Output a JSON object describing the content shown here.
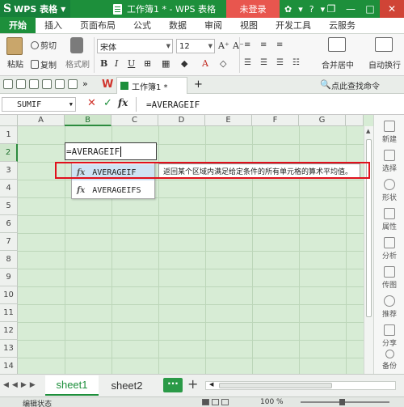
{
  "app": {
    "logo_text": "WPS 表格",
    "doc_title": "工作簿1 * - WPS 表格",
    "login_button": "未登录"
  },
  "menu_tabs": [
    "开始",
    "插入",
    "页面布局",
    "公式",
    "数据",
    "审阅",
    "视图",
    "开发工具",
    "云服务"
  ],
  "ribbon": {
    "paste": "粘贴",
    "cut": "剪切",
    "copy": "复制",
    "format_painter": "格式刷",
    "font_name": "宋体",
    "font_size": "12",
    "merge_center": "合并居中",
    "wrap_text": "自动换行"
  },
  "quickbar": {
    "doc_tab": "工作簿1 *",
    "find_command": "点此查找命令"
  },
  "formula_bar": {
    "name_box": "SUMIF",
    "fx": "fx",
    "formula": "=AVERAGEIF"
  },
  "grid": {
    "columns": [
      "A",
      "B",
      "C",
      "D",
      "E",
      "F",
      "G"
    ],
    "rows": [
      "1",
      "2",
      "3",
      "4",
      "5",
      "6",
      "7",
      "8",
      "9",
      "10",
      "11",
      "12",
      "13",
      "14"
    ],
    "edit_cell_value": "=AVERAGEIF"
  },
  "autocomplete": {
    "items": [
      {
        "name": "AVERAGEIF"
      },
      {
        "name": "AVERAGEIFS"
      }
    ],
    "tooltip": "返回某个区域内满足给定条件的所有单元格的算术平均值。"
  },
  "sidebar": [
    "新建",
    "选择",
    "形状",
    "属性",
    "分析",
    "传图",
    "推荐",
    "分享",
    "备份"
  ],
  "sheets": [
    "sheet1",
    "sheet2"
  ],
  "status": {
    "mode": "编辑状态",
    "zoom": "100 %"
  },
  "colors": {
    "brand": "#1d8f3b",
    "grid_bg": "#d7ecd5",
    "highlight_box": "#e0101c"
  }
}
